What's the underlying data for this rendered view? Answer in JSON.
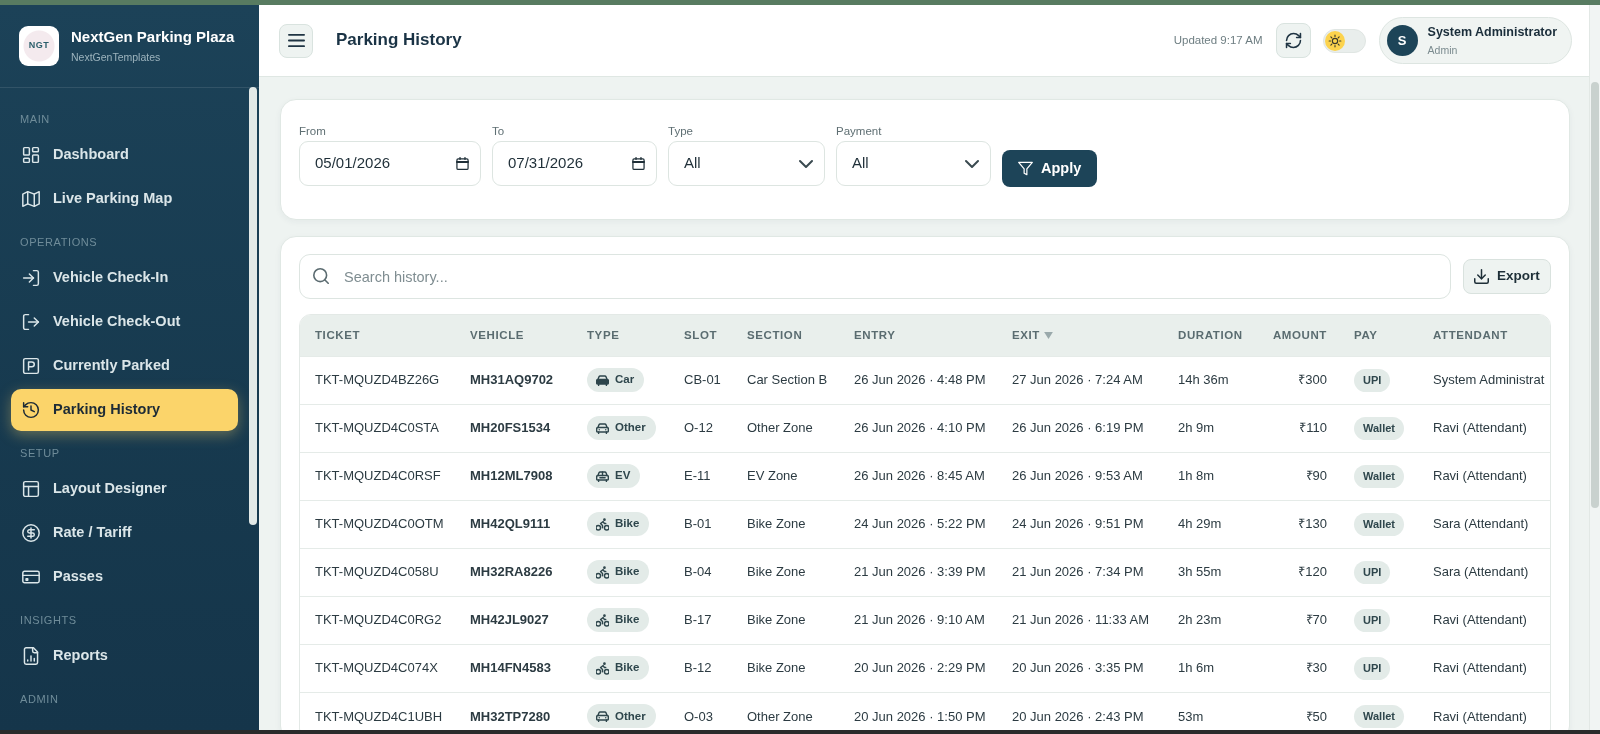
{
  "brand": {
    "logo_text": "NGT",
    "title": "NextGen Parking Plaza",
    "subtitle": "NextGenTemplates"
  },
  "sidebar": {
    "sections": [
      {
        "label": "MAIN",
        "items": [
          {
            "label": "Dashboard",
            "kind": "dashboard",
            "selected": false
          },
          {
            "label": "Live Parking Map",
            "kind": "map",
            "selected": false
          }
        ]
      },
      {
        "label": "OPERATIONS",
        "items": [
          {
            "label": "Vehicle Check-In",
            "kind": "check_in",
            "selected": false
          },
          {
            "label": "Vehicle Check-Out",
            "kind": "check_out",
            "selected": false
          },
          {
            "label": "Currently Parked",
            "kind": "parking",
            "selected": false
          },
          {
            "label": "Parking History",
            "kind": "history",
            "selected": true
          }
        ]
      },
      {
        "label": "SETUP",
        "items": [
          {
            "label": "Layout Designer",
            "kind": "layout",
            "selected": false
          },
          {
            "label": "Rate / Tariff",
            "kind": "rate",
            "selected": false
          },
          {
            "label": "Passes",
            "kind": "pass",
            "selected": false
          }
        ]
      },
      {
        "label": "INSIGHTS",
        "items": [
          {
            "label": "Reports",
            "kind": "report",
            "selected": false
          }
        ]
      },
      {
        "label": "ADMIN"
      }
    ]
  },
  "header": {
    "title": "Parking History",
    "updated": "Updated 9:17 AM",
    "dark_mode": false,
    "user": {
      "initial": "S",
      "name": "System Administrator",
      "role": "Admin"
    }
  },
  "filters": {
    "fields": [
      {
        "label": "From",
        "kind": "date",
        "value": "05/01/2026"
      },
      {
        "label": "To",
        "kind": "date",
        "value": "07/31/2026"
      },
      {
        "label": "Type",
        "kind": "select",
        "value": "All"
      },
      {
        "label": "Payment",
        "kind": "select",
        "value": "All"
      }
    ],
    "apply": "Apply"
  },
  "history": {
    "search": {
      "placeholder": "Search history..."
    },
    "export": "Export",
    "columns": [
      {
        "label": "TICKET",
        "sorted": false
      },
      {
        "label": "VEHICLE",
        "sorted": false
      },
      {
        "label": "TYPE",
        "sorted": false
      },
      {
        "label": "SLOT",
        "sorted": false
      },
      {
        "label": "SECTION",
        "sorted": false
      },
      {
        "label": "ENTRY",
        "sorted": false
      },
      {
        "label": "EXIT",
        "sorted": true
      },
      {
        "label": "DURATION",
        "sorted": false
      },
      {
        "label": "AMOUNT",
        "sorted": false
      },
      {
        "label": "PAY",
        "sorted": false
      },
      {
        "label": "ATTENDANT",
        "sorted": false
      }
    ],
    "rows": [
      {
        "ticket": "TKT-MQUZD4BZ26G",
        "vehicle": "MH31AQ9702",
        "type": {
          "label": "Car",
          "kind": "car"
        },
        "slot": "CB-01",
        "section": "Car Section B",
        "entry": "26 Jun 2026 · 4:48 PM",
        "exit": "27 Jun 2026 · 7:24 AM",
        "duration": "14h 36m",
        "amount": "₹300",
        "pay": "UPI",
        "attendant": "System Administrat"
      },
      {
        "ticket": "TKT-MQUZD4C0STA",
        "vehicle": "MH20FS1534",
        "type": {
          "label": "Other",
          "kind": "other"
        },
        "slot": "O-12",
        "section": "Other Zone",
        "entry": "26 Jun 2026 · 4:10 PM",
        "exit": "26 Jun 2026 · 6:19 PM",
        "duration": "2h 9m",
        "amount": "₹110",
        "pay": "Wallet",
        "attendant": "Ravi (Attendant)"
      },
      {
        "ticket": "TKT-MQUZD4C0RSF",
        "vehicle": "MH12ML7908",
        "type": {
          "label": "EV",
          "kind": "ev"
        },
        "slot": "E-11",
        "section": "EV Zone",
        "entry": "26 Jun 2026 · 8:45 AM",
        "exit": "26 Jun 2026 · 9:53 AM",
        "duration": "1h 8m",
        "amount": "₹90",
        "pay": "Wallet",
        "attendant": "Ravi (Attendant)"
      },
      {
        "ticket": "TKT-MQUZD4C0OTM",
        "vehicle": "MH42QL9111",
        "type": {
          "label": "Bike",
          "kind": "bike"
        },
        "slot": "B-01",
        "section": "Bike Zone",
        "entry": "24 Jun 2026 · 5:22 PM",
        "exit": "24 Jun 2026 · 9:51 PM",
        "duration": "4h 29m",
        "amount": "₹130",
        "pay": "Wallet",
        "attendant": "Sara (Attendant)"
      },
      {
        "ticket": "TKT-MQUZD4C058U",
        "vehicle": "MH32RA8226",
        "type": {
          "label": "Bike",
          "kind": "bike"
        },
        "slot": "B-04",
        "section": "Bike Zone",
        "entry": "21 Jun 2026 · 3:39 PM",
        "exit": "21 Jun 2026 · 7:34 PM",
        "duration": "3h 55m",
        "amount": "₹120",
        "pay": "UPI",
        "attendant": "Sara (Attendant)"
      },
      {
        "ticket": "TKT-MQUZD4C0RG2",
        "vehicle": "MH42JL9027",
        "type": {
          "label": "Bike",
          "kind": "bike"
        },
        "slot": "B-17",
        "section": "Bike Zone",
        "entry": "21 Jun 2026 · 9:10 AM",
        "exit": "21 Jun 2026 · 11:33 AM",
        "duration": "2h 23m",
        "amount": "₹70",
        "pay": "UPI",
        "attendant": "Ravi (Attendant)"
      },
      {
        "ticket": "TKT-MQUZD4C074X",
        "vehicle": "MH14FN4583",
        "type": {
          "label": "Bike",
          "kind": "bike"
        },
        "slot": "B-12",
        "section": "Bike Zone",
        "entry": "20 Jun 2026 · 2:29 PM",
        "exit": "20 Jun 2026 · 3:35 PM",
        "duration": "1h 6m",
        "amount": "₹30",
        "pay": "UPI",
        "attendant": "Ravi (Attendant)"
      },
      {
        "ticket": "TKT-MQUZD4C1UBH",
        "vehicle": "MH32TP7280",
        "type": {
          "label": "Other",
          "kind": "other"
        },
        "slot": "O-03",
        "section": "Other Zone",
        "entry": "20 Jun 2026 · 1:50 PM",
        "exit": "20 Jun 2026 · 2:43 PM",
        "duration": "53m",
        "amount": "₹50",
        "pay": "Wallet",
        "attendant": "Ravi (Attendant)"
      }
    ]
  }
}
